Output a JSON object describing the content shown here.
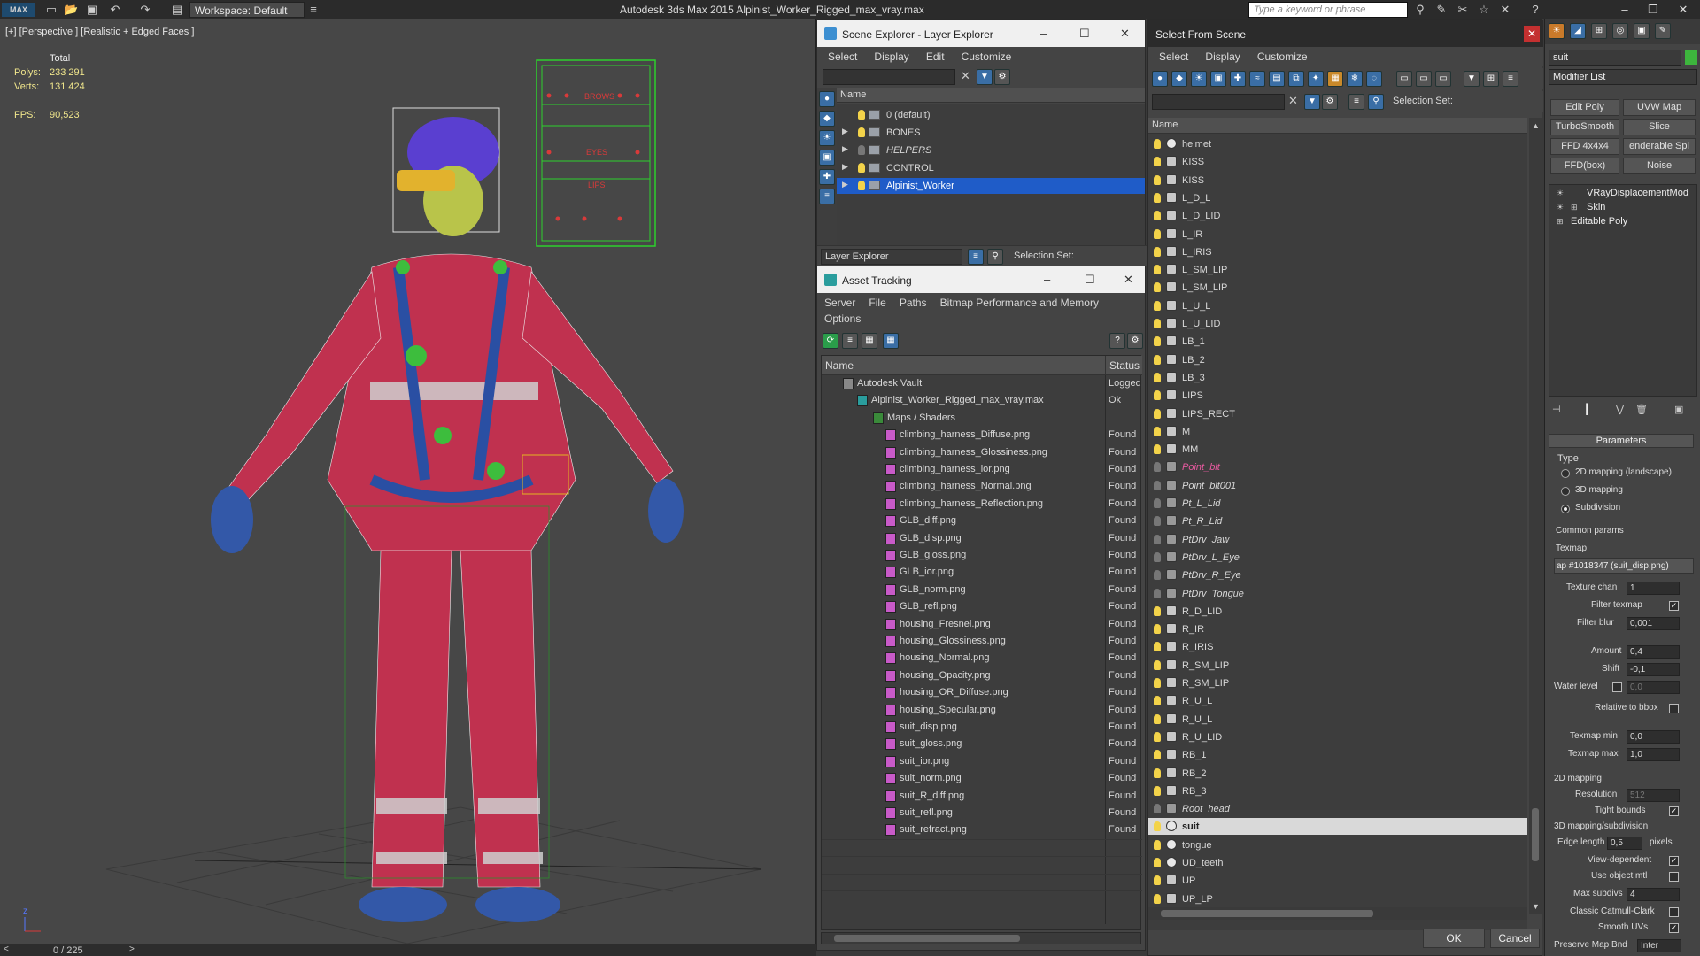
{
  "app": {
    "title": "Autodesk 3ds Max  2015     Alpinist_Worker_Rigged_max_vray.max",
    "logo": "MAX",
    "workspace": "Workspace: Default",
    "search_placeholder": "Type a keyword or phrase"
  },
  "viewport": {
    "label": "[+] [Perspective ] [Realistic + Edged Faces ]",
    "total_label": "Total",
    "polys_label": "Polys:",
    "polys_value": "233 291",
    "verts_label": "Verts:",
    "verts_value": "131 424",
    "fps_label": "FPS:",
    "fps_value": "90,523",
    "panel_words": [
      "BROWS",
      "EYES",
      "LIPS"
    ],
    "axis_z": "z"
  },
  "timebar": {
    "frame": "0 / 225"
  },
  "scene_explorer": {
    "title": "Scene Explorer - Layer Explorer",
    "menu": [
      "Select",
      "Display",
      "Edit",
      "Customize"
    ],
    "col_name": "Name",
    "layers": [
      {
        "name": "0 (default)",
        "on": true,
        "italic": false,
        "expand": false
      },
      {
        "name": "BONES",
        "on": true,
        "italic": false,
        "expand": true
      },
      {
        "name": "HELPERS",
        "on": false,
        "italic": true,
        "expand": true
      },
      {
        "name": "CONTROL",
        "on": true,
        "italic": false,
        "expand": true
      },
      {
        "name": "Alpinist_Worker",
        "on": true,
        "italic": false,
        "expand": true,
        "selected": true
      }
    ],
    "footer_dropdown": "Layer Explorer",
    "footer_selection": "Selection Set:"
  },
  "asset_tracking": {
    "title": "Asset Tracking",
    "menu": [
      "Server",
      "File",
      "Paths",
      "Bitmap Performance and Memory"
    ],
    "menu2": [
      "Options"
    ],
    "col_name": "Name",
    "col_status": "Status",
    "vault": {
      "name": "Autodesk Vault",
      "status": "Logged"
    },
    "file": {
      "name": "Alpinist_Worker_Rigged_max_vray.max",
      "status": "Ok"
    },
    "folder": "Maps / Shaders",
    "maps": [
      {
        "name": "climbing_harness_Diffuse.png",
        "status": "Found"
      },
      {
        "name": "climbing_harness_Glossiness.png",
        "status": "Found"
      },
      {
        "name": "climbing_harness_ior.png",
        "status": "Found"
      },
      {
        "name": "climbing_harness_Normal.png",
        "status": "Found"
      },
      {
        "name": "climbing_harness_Reflection.png",
        "status": "Found"
      },
      {
        "name": "GLB_diff.png",
        "status": "Found"
      },
      {
        "name": "GLB_disp.png",
        "status": "Found"
      },
      {
        "name": "GLB_gloss.png",
        "status": "Found"
      },
      {
        "name": "GLB_ior.png",
        "status": "Found"
      },
      {
        "name": "GLB_norm.png",
        "status": "Found"
      },
      {
        "name": "GLB_refl.png",
        "status": "Found"
      },
      {
        "name": "housing_Fresnel.png",
        "status": "Found"
      },
      {
        "name": "housing_Glossiness.png",
        "status": "Found"
      },
      {
        "name": "housing_Normal.png",
        "status": "Found"
      },
      {
        "name": "housing_Opacity.png",
        "status": "Found"
      },
      {
        "name": "housing_OR_Diffuse.png",
        "status": "Found"
      },
      {
        "name": "housing_Specular.png",
        "status": "Found"
      },
      {
        "name": "suit_disp.png",
        "status": "Found"
      },
      {
        "name": "suit_gloss.png",
        "status": "Found"
      },
      {
        "name": "suit_ior.png",
        "status": "Found"
      },
      {
        "name": "suit_norm.png",
        "status": "Found"
      },
      {
        "name": "suit_R_diff.png",
        "status": "Found"
      },
      {
        "name": "suit_refl.png",
        "status": "Found"
      },
      {
        "name": "suit_refract.png",
        "status": "Found"
      }
    ]
  },
  "select_from_scene": {
    "title": "Select From Scene",
    "menu": [
      "Select",
      "Display",
      "Customize"
    ],
    "selection_set": "Selection Set:",
    "col_name": "Name",
    "items": [
      {
        "name": "helmet",
        "kind": "mesh"
      },
      {
        "name": "KISS",
        "kind": "obj"
      },
      {
        "name": "KISS",
        "kind": "obj"
      },
      {
        "name": "L_D_L",
        "kind": "obj"
      },
      {
        "name": "L_D_LID",
        "kind": "obj"
      },
      {
        "name": "L_IR",
        "kind": "obj"
      },
      {
        "name": "L_IRIS",
        "kind": "obj"
      },
      {
        "name": "L_SM_LIP",
        "kind": "obj"
      },
      {
        "name": "L_SM_LIP",
        "kind": "obj"
      },
      {
        "name": "L_U_L",
        "kind": "obj"
      },
      {
        "name": "L_U_LID",
        "kind": "obj"
      },
      {
        "name": "LB_1",
        "kind": "obj"
      },
      {
        "name": "LB_2",
        "kind": "obj"
      },
      {
        "name": "LB_3",
        "kind": "obj"
      },
      {
        "name": "LIPS",
        "kind": "obj"
      },
      {
        "name": "LIPS_RECT",
        "kind": "obj"
      },
      {
        "name": "M",
        "kind": "obj"
      },
      {
        "name": "MM",
        "kind": "obj"
      },
      {
        "name": "Point_blt",
        "kind": "helper-pink"
      },
      {
        "name": "Point_blt001",
        "kind": "helper"
      },
      {
        "name": "Pt_L_Lid",
        "kind": "helper"
      },
      {
        "name": "Pt_R_Lid",
        "kind": "helper"
      },
      {
        "name": "PtDrv_Jaw",
        "kind": "helper"
      },
      {
        "name": "PtDrv_L_Eye",
        "kind": "helper"
      },
      {
        "name": "PtDrv_R_Eye",
        "kind": "helper"
      },
      {
        "name": "PtDrv_Tongue",
        "kind": "helper"
      },
      {
        "name": "R_D_LID",
        "kind": "obj"
      },
      {
        "name": "R_IR",
        "kind": "obj"
      },
      {
        "name": "R_IRIS",
        "kind": "obj"
      },
      {
        "name": "R_SM_LIP",
        "kind": "obj"
      },
      {
        "name": "R_SM_LIP",
        "kind": "obj"
      },
      {
        "name": "R_U_L",
        "kind": "obj"
      },
      {
        "name": "R_U_L",
        "kind": "obj"
      },
      {
        "name": "R_U_LID",
        "kind": "obj"
      },
      {
        "name": "RB_1",
        "kind": "obj"
      },
      {
        "name": "RB_2",
        "kind": "obj"
      },
      {
        "name": "RB_3",
        "kind": "obj"
      },
      {
        "name": "Root_head",
        "kind": "helper"
      },
      {
        "name": "suit",
        "kind": "mesh",
        "selected": true
      },
      {
        "name": "tongue",
        "kind": "mesh"
      },
      {
        "name": "UD_teeth",
        "kind": "mesh"
      },
      {
        "name": "UP",
        "kind": "obj"
      },
      {
        "name": "UP_LP",
        "kind": "obj"
      }
    ],
    "ok": "OK",
    "cancel": "Cancel"
  },
  "command_panel": {
    "object_name": "suit",
    "modifier_list": "Modifier List",
    "buttons": [
      "Edit Poly",
      "UVW Map",
      "TurboSmooth",
      "Slice",
      "FFD 4x4x4",
      "enderable Spl",
      "FFD(box)",
      "Noise"
    ],
    "stack": [
      "VRayDisplacementMod",
      "Skin",
      "Editable Poly"
    ],
    "rollout": "Parameters",
    "type_label": "Type",
    "types": [
      "2D mapping (landscape)",
      "3D mapping",
      "Subdivision"
    ],
    "type_selected": 2,
    "common_params": "Common params",
    "texmap_label": "Texmap",
    "texmap_value": "ap #1018347 (suit_disp.png)",
    "texture_chan_label": "Texture chan",
    "texture_chan": "1",
    "filter_texmap": "Filter texmap",
    "filter_blur_label": "Filter blur",
    "filter_blur": "0,001",
    "amount_label": "Amount",
    "amount": "0,4",
    "shift_label": "Shift",
    "shift": "-0,1",
    "water_level_label": "Water level",
    "water_level": "0,0",
    "relative_bbox": "Relative to bbox",
    "texmap_min_label": "Texmap min",
    "texmap_min": "0,0",
    "texmap_max_label": "Texmap max",
    "texmap_max": "1,0",
    "mapping2d": "2D mapping",
    "resolution_label": "Resolution",
    "resolution": "512",
    "tight_bounds": "Tight bounds",
    "subdiv_section": "3D mapping/subdivision",
    "edge_length_label": "Edge length",
    "edge_length": "0,5",
    "pixels": "pixels",
    "view_dependent": "View-dependent",
    "use_object_mtl": "Use object mtl",
    "max_subdivs_label": "Max subdivs",
    "max_subdivs": "4",
    "classic_cc": "Classic Catmull-Clark",
    "smooth_uvs": "Smooth UVs",
    "preserve_map": "Preserve Map Bnd",
    "preserve_value": "Inter"
  },
  "colors": {
    "accent": "#1f5cc8",
    "suit": "#c0314f",
    "harness": "#2a4fa3",
    "helper": "#e85aa0"
  }
}
